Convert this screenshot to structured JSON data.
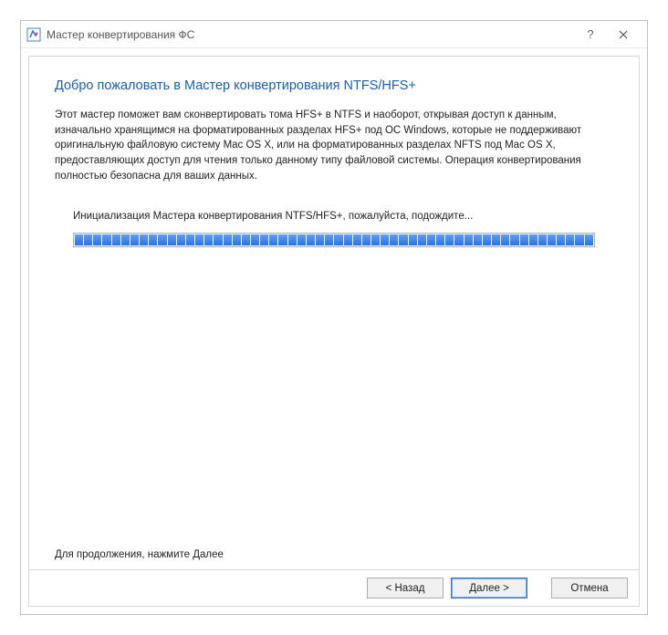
{
  "window": {
    "title": "Мастер конвертирования ФС"
  },
  "page": {
    "heading": "Добро пожаловать в Мастер конвертирования NTFS/HFS+",
    "description": "Этот мастер поможет вам сконвертировать тома HFS+ в NTFS и наоборот, открывая доступ к данным, изначально хранящимся на форматированных разделах HFS+ под ОС Windows, которые не поддерживают оригинальную файловую систему Mac OS X, или на форматированных разделах NFTS под Mac OS X, предоставляющих доступ для чтения только данному типу файловой системы. Операция конвертирования полностью безопасна для ваших данных.",
    "status": "Инициализация Мастера конвертирования NTFS/HFS+, пожалуйста, подождите...",
    "footer_hint": "Для продолжения, нажмите Далее"
  },
  "progress": {
    "percent": 100,
    "segments": 56
  },
  "buttons": {
    "back": "< Назад",
    "next": "Далее >",
    "cancel": "Отмена"
  }
}
